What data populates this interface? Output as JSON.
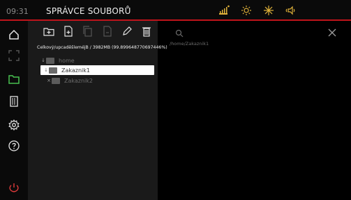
{
  "topbar": {
    "time": "09:31",
    "title": "SPRÁVCE SOUBORŮ"
  },
  "left_panel": {
    "usage_text": "Celkový/upcaděšleméjB / 3982MB (99.899648770697446%)",
    "tree": [
      {
        "label": "home",
        "level": 0,
        "arrow": "↓",
        "state": "dim"
      },
      {
        "label": "Zakaznik1",
        "level": 1,
        "arrow": "↓",
        "state": "selected"
      },
      {
        "label": "Zakaznik2",
        "level": 1,
        "arrow": "×",
        "state": "dim"
      }
    ]
  },
  "right_panel": {
    "path": "/home/Zakaznik1"
  },
  "colors": {
    "accent_red": "#c0141b",
    "icon_yellow": "#e0b23a",
    "icon_green": "#49c251",
    "power_red": "#e03b3b"
  },
  "icons": {
    "top": [
      "signal-icon",
      "brightness-icon",
      "snow-icon",
      "speaker-icon"
    ],
    "side": [
      "home-icon",
      "expand-icon",
      "folder-icon",
      "door-icon",
      "settings-icon",
      "help-icon",
      "power-icon"
    ]
  }
}
